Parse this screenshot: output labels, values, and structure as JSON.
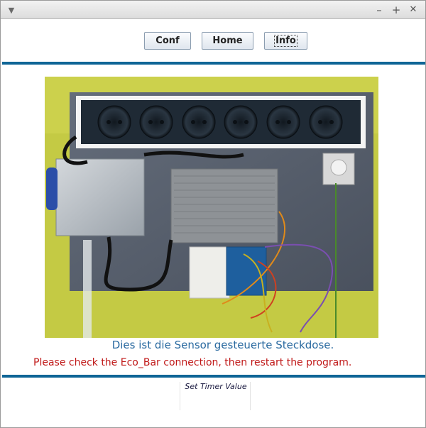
{
  "window": {
    "menu_glyph": "▼",
    "minimize_glyph": "–",
    "maximize_glyph": "+",
    "close_glyph": "✕"
  },
  "nav": {
    "buttons": [
      {
        "label": "Conf"
      },
      {
        "label": "Home"
      },
      {
        "label": "Info"
      }
    ]
  },
  "photo": {
    "subject": "sensor-controlled power strip board",
    "colors": {
      "background": "#c6cc45",
      "board": "#5a6270",
      "strip": "#1f2a35"
    }
  },
  "caption": "Dies ist die Sensor gesteuerte Steckdose.",
  "error_message": "Please check the Eco_Bar connection, then restart the program.",
  "timer": {
    "label": "Set Timer Value"
  },
  "colors": {
    "accent_rule": "#0f6596",
    "caption": "#2a6aa0",
    "error": "#c01818"
  }
}
